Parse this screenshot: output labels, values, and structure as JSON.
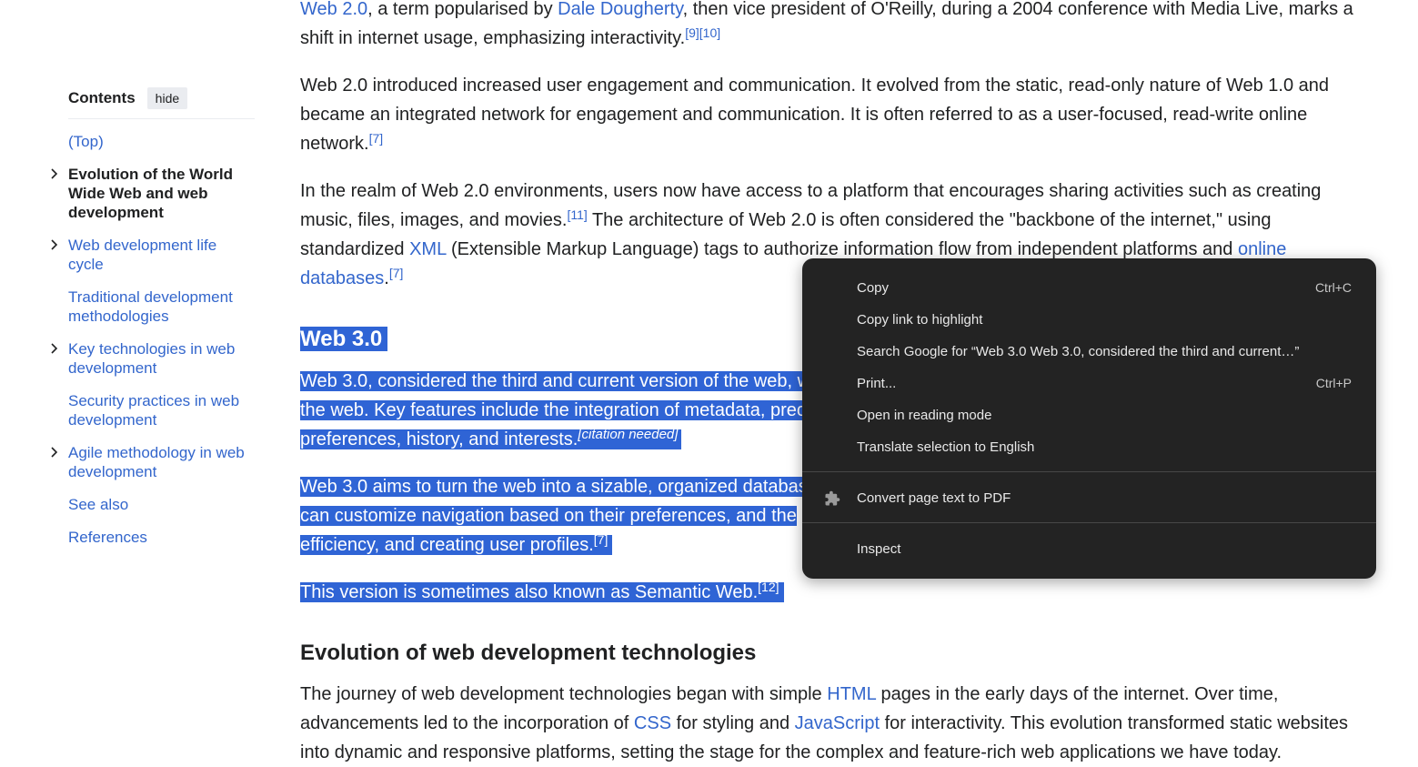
{
  "toc": {
    "title": "Contents",
    "hide_label": "hide",
    "items": [
      {
        "label": "(Top)",
        "current": false,
        "expandable": false
      },
      {
        "label": "Evolution of the World Wide Web and web development",
        "current": true,
        "expandable": true
      },
      {
        "label": "Web development life cycle",
        "current": false,
        "expandable": true
      },
      {
        "label": "Traditional development methodologies",
        "current": false,
        "expandable": false
      },
      {
        "label": "Key technologies in web development",
        "current": false,
        "expandable": true
      },
      {
        "label": "Security practices in web development",
        "current": false,
        "expandable": false
      },
      {
        "label": "Agile methodology in web development",
        "current": false,
        "expandable": true
      },
      {
        "label": "See also",
        "current": false,
        "expandable": false
      },
      {
        "label": "References",
        "current": false,
        "expandable": false
      }
    ]
  },
  "article": {
    "p0": {
      "link1": "Web 2.0",
      "t1": ", a term popularised by ",
      "link2": "Dale Dougherty",
      "t2": ", then vice president of O'Reilly, during a 2004 conference with Media Live, marks a shift in internet usage, emphasizing interactivity.",
      "ref1": "[9]",
      "ref2": "[10]"
    },
    "p1": {
      "text": "Web 2.0 introduced increased user engagement and communication. It evolved from the static, read-only nature of Web 1.0 and became an integrated network for engagement and communication. It is often referred to as a user-focused, read-write online network.",
      "ref": "[7]"
    },
    "p2": {
      "t1": "In the realm of Web 2.0 environments, users now have access to a platform that encourages sharing activities such as creating music, files, images, and movies.",
      "ref1": "[11]",
      "t2": " The architecture of Web 2.0 is often considered the \"backbone of the internet,\" using standardized ",
      "link1": "XML",
      "t3": " (Extensible Markup Language) tags to authorize information flow from independent platforms and ",
      "link2": "online databases",
      "t4": ".",
      "ref2": "[7]"
    },
    "h_web3": "Web 3.0",
    "p3": {
      "line1": "Web 3.0, considered the third and current version of the web, w",
      "line2": "the web. Key features include the integration of metadata, prec",
      "line3": "preferences, history, and interests.",
      "cite": "[citation needed]"
    },
    "p4": {
      "line1": "Web 3.0 aims to turn the web into a sizable, organized databas",
      "line2": "can customize navigation based on their preferences, and the ",
      "line3": "efficiency, and creating user profiles.",
      "ref": "[7]"
    },
    "p5": {
      "text": "This version is sometimes also known as Semantic Web.",
      "ref": "[12]"
    },
    "h_evo": "Evolution of web development technologies",
    "p6": {
      "t1": "The journey of web development technologies began with simple ",
      "link1": "HTML",
      "t2": " pages in the early days of the internet. Over time, advancements led to the incorporation of ",
      "link2": "CSS",
      "t3": " for styling and ",
      "link3": "JavaScript",
      "t4": " for interactivity. This evolution transformed static websites into dynamic and responsive platforms, setting the stage for the complex and feature-rich web applications we have today."
    }
  },
  "context_menu": {
    "items": [
      {
        "label": "Copy",
        "shortcut": "Ctrl+C"
      },
      {
        "label": "Copy link to highlight",
        "shortcut": ""
      },
      {
        "label": "Search Google for “Web 3.0 Web 3.0, considered the third and current…”",
        "shortcut": ""
      },
      {
        "label": "Print...",
        "shortcut": "Ctrl+P"
      },
      {
        "label": "Open in reading mode",
        "shortcut": ""
      },
      {
        "label": "Translate selection to English",
        "shortcut": ""
      },
      {
        "label": "Convert page text to PDF",
        "shortcut": "",
        "icon": "puzzle-icon"
      },
      {
        "label": "Inspect",
        "shortcut": ""
      }
    ]
  },
  "colors": {
    "link": "#3366cc",
    "selection": "#2f64d5",
    "menu_bg": "#232323"
  }
}
